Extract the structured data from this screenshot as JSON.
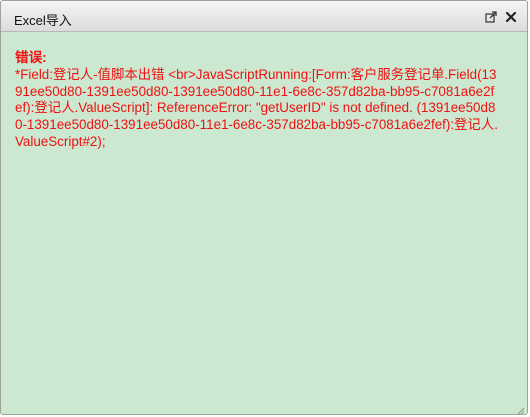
{
  "dialog": {
    "title": "Excel导入",
    "buttons": {
      "popout_icon": "external-window-icon",
      "close_icon": "close-icon"
    }
  },
  "error": {
    "label": "错误:",
    "message": "*Field:登记人-值脚本出错 <br>JavaScriptRunning:[Form:客户服务登记单.Field(1391ee50d80-1391ee50d80-1391ee50d80-11e1-6e8c-357d82ba-bb95-c7081a6e2fef):登记人.ValueScript]: ReferenceError: \"getUserID\" is not defined. (1391ee50d80-1391ee50d80-1391ee50d80-11e1-6e8c-357d82ba-bb95-c7081a6e2fef):登记人.ValueScript#2);"
  },
  "colors": {
    "background": "#cde8d0",
    "error_text": "#ee1111",
    "titlebar": "#e6e6e6"
  }
}
